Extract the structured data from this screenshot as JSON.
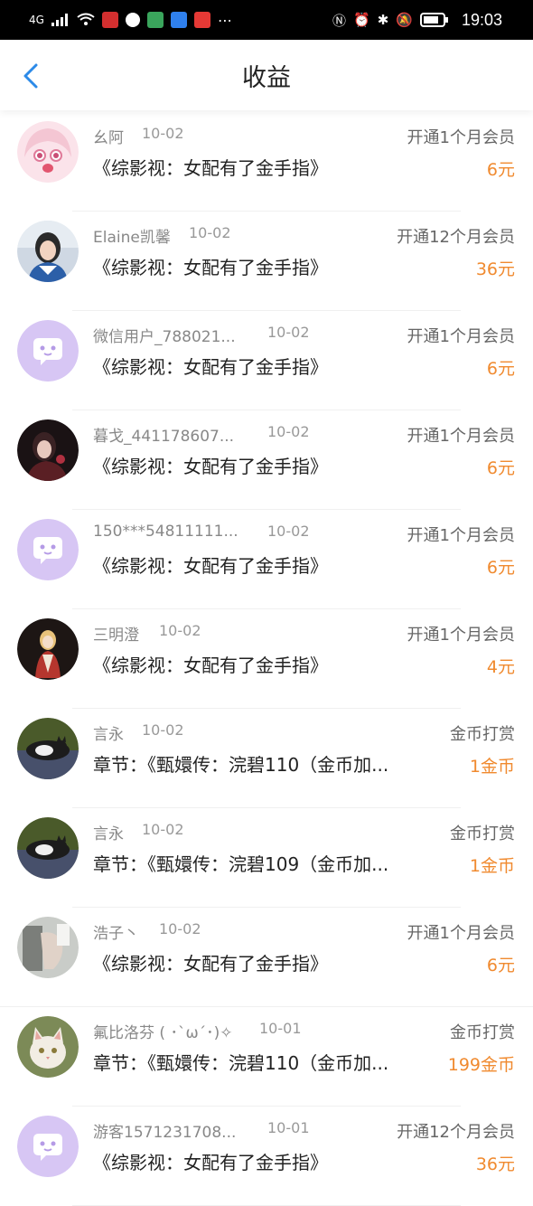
{
  "status_bar": {
    "signal": "4G",
    "time": "19:03"
  },
  "nav": {
    "title": "收益"
  },
  "rows": [
    {
      "name": "幺阿",
      "date": "10-02",
      "type": "开通1个月会员",
      "content": "《综影视：女配有了金手指》",
      "amount": "6元",
      "avatar": "anime-girl-avatar"
    },
    {
      "name": "Elaine凯馨",
      "date": "10-02",
      "type": "开通12个月会员",
      "content": "《综影视：女配有了金手指》",
      "amount": "36元",
      "avatar": "photo-avatar"
    },
    {
      "name": "微信用户_788021...",
      "date": "10-02",
      "type": "开通1个月会员",
      "content": "《综影视：女配有了金手指》",
      "amount": "6元",
      "avatar": "default-chat-avatar"
    },
    {
      "name": "暮戈_441178607...",
      "date": "10-02",
      "type": "开通1个月会员",
      "content": "《综影视：女配有了金手指》",
      "amount": "6元",
      "avatar": "dark-photo-avatar"
    },
    {
      "name": "150***54811111...",
      "date": "10-02",
      "type": "开通1个月会员",
      "content": "《综影视：女配有了金手指》",
      "amount": "6元",
      "avatar": "default-chat-avatar"
    },
    {
      "name": "三明澄",
      "date": "10-02",
      "type": "开通1个月会员",
      "content": "《综影视：女配有了金手指》",
      "amount": "4元",
      "avatar": "illustration-avatar"
    },
    {
      "name": "言永",
      "date": "10-02",
      "type": "金币打赏",
      "content": "章节：《甄嬛传：浣碧110（金币加...",
      "amount": "1金币",
      "avatar": "cat-avatar"
    },
    {
      "name": "言永",
      "date": "10-02",
      "type": "金币打赏",
      "content": "章节：《甄嬛传：浣碧109（金币加...",
      "amount": "1金币",
      "avatar": "cat-avatar"
    },
    {
      "name": "浩子丶",
      "date": "10-02",
      "type": "开通1个月会员",
      "content": "《综影视：女配有了金手指》",
      "amount": "6元",
      "avatar": "hand-photo-avatar"
    },
    {
      "name": "氟比洛芬 ( ･`ω´･)✧",
      "date": "10-01",
      "type": "金币打赏",
      "content": "章节：《甄嬛传：浣碧110（金币加...",
      "amount": "199金币",
      "avatar": "white-cat-avatar"
    },
    {
      "name": "游客1571231708...",
      "date": "10-01",
      "type": "开通12个月会员",
      "content": "《综影视：女配有了金手指》",
      "amount": "36元",
      "avatar": "default-chat-avatar"
    }
  ],
  "colors": {
    "accent_orange": "#f08a2f",
    "back_blue": "#2c8ae8",
    "default_avatar_bg": "#d7c6f4"
  }
}
